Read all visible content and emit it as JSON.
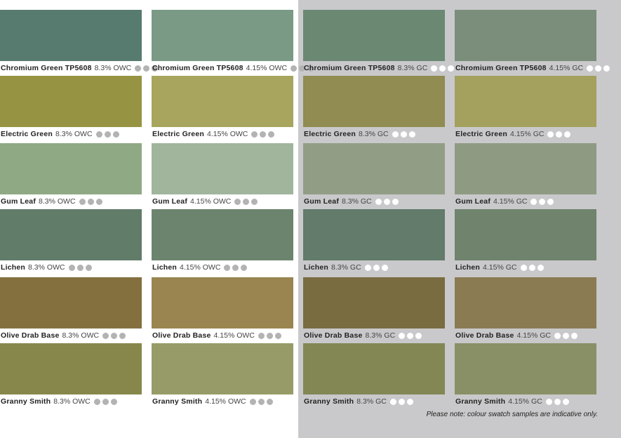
{
  "columns": [
    {
      "finish": "OWC",
      "swatches": [
        {
          "name": "Chromium Green TP5608",
          "spec": "8.3% OWC",
          "color": "#577c6f"
        },
        {
          "name": "Electric Green",
          "spec": "8.3% OWC",
          "color": "#969342"
        },
        {
          "name": "Gum Leaf",
          "spec": "8.3% OWC",
          "color": "#8fa985"
        },
        {
          "name": "Lichen",
          "spec": "8.3% OWC",
          "color": "#627c6a"
        },
        {
          "name": "Olive Drab Base",
          "spec": "8.3% OWC",
          "color": "#846f3f"
        },
        {
          "name": "Granny Smith",
          "spec": "8.3% OWC",
          "color": "#87874b"
        }
      ]
    },
    {
      "finish": "OWC",
      "swatches": [
        {
          "name": "Chromium Green TP5608",
          "spec": "4.15% OWC",
          "color": "#7a9a85"
        },
        {
          "name": "Electric Green",
          "spec": "4.15% OWC",
          "color": "#a7a55e"
        },
        {
          "name": "Gum Leaf",
          "spec": "4.15% OWC",
          "color": "#a1b59c"
        },
        {
          "name": "Lichen",
          "spec": "4.15% OWC",
          "color": "#6c846e"
        },
        {
          "name": "Olive Drab Base",
          "spec": "4.15% OWC",
          "color": "#9a8550"
        },
        {
          "name": "Granny Smith",
          "spec": "4.15% OWC",
          "color": "#979b67"
        }
      ]
    },
    {
      "finish": "GC",
      "swatches": [
        {
          "name": "Chromium Green TP5608",
          "spec": "8.3% GC",
          "color": "#6b8873"
        },
        {
          "name": "Electric Green",
          "spec": "8.3% GC",
          "color": "#908c52"
        },
        {
          "name": "Gum Leaf",
          "spec": "8.3% GC",
          "color": "#929d86"
        },
        {
          "name": "Lichen",
          "spec": "8.3% GC",
          "color": "#627b6a"
        },
        {
          "name": "Olive Drab Base",
          "spec": "8.3% GC",
          "color": "#7a6c41"
        },
        {
          "name": "Granny Smith",
          "spec": "8.3% GC",
          "color": "#838754"
        }
      ]
    },
    {
      "finish": "GC",
      "swatches": [
        {
          "name": "Chromium Green TP5608",
          "spec": "4.15% GC",
          "color": "#7a8e7b"
        },
        {
          "name": "Electric Green",
          "spec": "4.15% GC",
          "color": "#a4a05d"
        },
        {
          "name": "Gum Leaf",
          "spec": "4.15% GC",
          "color": "#8f9a83"
        },
        {
          "name": "Lichen",
          "spec": "4.15% GC",
          "color": "#6f836d"
        },
        {
          "name": "Olive Drab Base",
          "spec": "4.15% GC",
          "color": "#8b7b52"
        },
        {
          "name": "Granny Smith",
          "spec": "4.15% GC",
          "color": "#8a9066"
        }
      ]
    }
  ],
  "note": "Please note: colour swatch samples are indicative only."
}
